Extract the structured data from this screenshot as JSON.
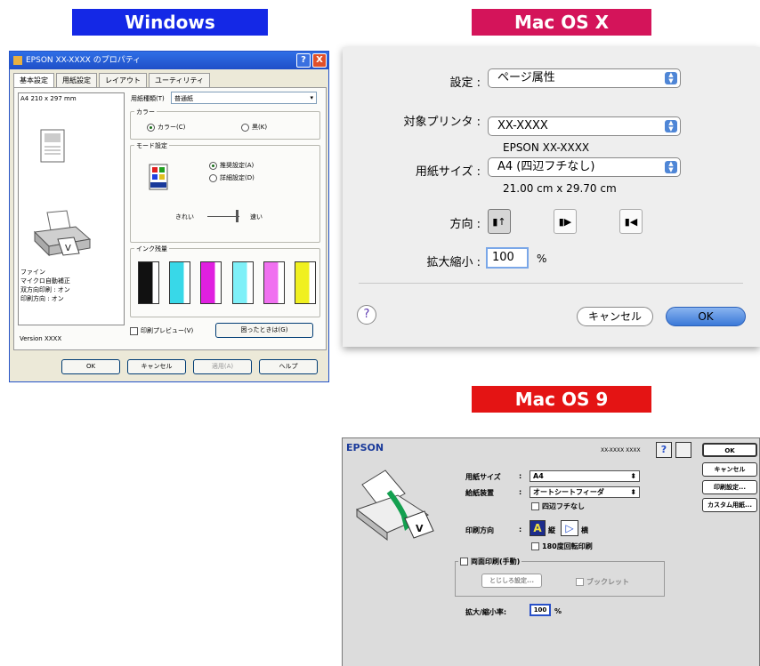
{
  "banners": {
    "windows": "Windows",
    "macosx": "Mac OS X",
    "macos9": "Mac OS 9"
  },
  "windows": {
    "title": "EPSON XX-XXXX のプロパティ",
    "help_btn": "?",
    "close_btn": "X",
    "tabs": [
      "基本設定",
      "用紙設定",
      "レイアウト",
      "ユーティリティ"
    ],
    "paper_size": "A4 210 x 297 mm",
    "paper_type_label": "用紙種類(T)",
    "paper_type_value": "普通紙",
    "color_label": "カラー",
    "color_options": [
      "カラー(C)",
      "黒(K)"
    ],
    "mode_label": "モード設定",
    "mode_options": [
      "推奨設定(A)",
      "詳細設定(D)"
    ],
    "quality_left": "きれい",
    "quality_right": "速い",
    "preview_info": [
      "ファイン",
      "マイクロ自動補正",
      "双方向印刷 : オン",
      "印刷方向 : オン"
    ],
    "ink_label": "インク残量",
    "ink_colors": [
      "#111111",
      "#38d8e8",
      "#e020e0",
      "#7ef0f8",
      "#f070f0",
      "#f0f020"
    ],
    "print_preview": "印刷プレビュー(V)",
    "trouble_button": "困ったときは(G)",
    "version": "Version XXXX",
    "buttons": {
      "ok": "OK",
      "cancel": "キャンセル",
      "apply": "適用(A)",
      "help": "ヘルプ"
    },
    "brand": "EPSON"
  },
  "macosx": {
    "settings_label": "設定 :",
    "settings_value": "ページ属性",
    "printer_label": "対象プリンタ :",
    "printer_value": "XX-XXXX",
    "printer_desc": "EPSON XX-XXXX",
    "paper_label": "用紙サイズ :",
    "paper_value": "A4 (四辺フチなし)",
    "paper_dims": "21.00 cm x 29.70 cm",
    "orientation_label": "方向 :",
    "scale_label": "拡大縮小 :",
    "scale_value": "100",
    "scale_unit": "%",
    "help": "?",
    "cancel": "キャンセル",
    "ok": "OK"
  },
  "macos9": {
    "logo": "EPSON",
    "model": "XX-XXXX XXXX",
    "help": "?",
    "paper_size_label": "用紙サイズ",
    "paper_size_value": "A4",
    "feed_label": "給紙装置",
    "feed_value": "オートシートフィーダ",
    "borderless": "四辺フチなし",
    "orientation_label": "印刷方向",
    "portrait": "縦",
    "landscape": "横",
    "rotate": "180度回転印刷",
    "duplex_label": "両面印刷(手動)",
    "duplex_settings": "とじしろ設定...",
    "booklet": "ブックレット",
    "scale_label": "拡大/縮小率:",
    "scale_value": "100",
    "scale_unit": "%",
    "buttons": [
      "OK",
      "キャンセル",
      "印刷設定...",
      "カスタム用紙..."
    ]
  }
}
